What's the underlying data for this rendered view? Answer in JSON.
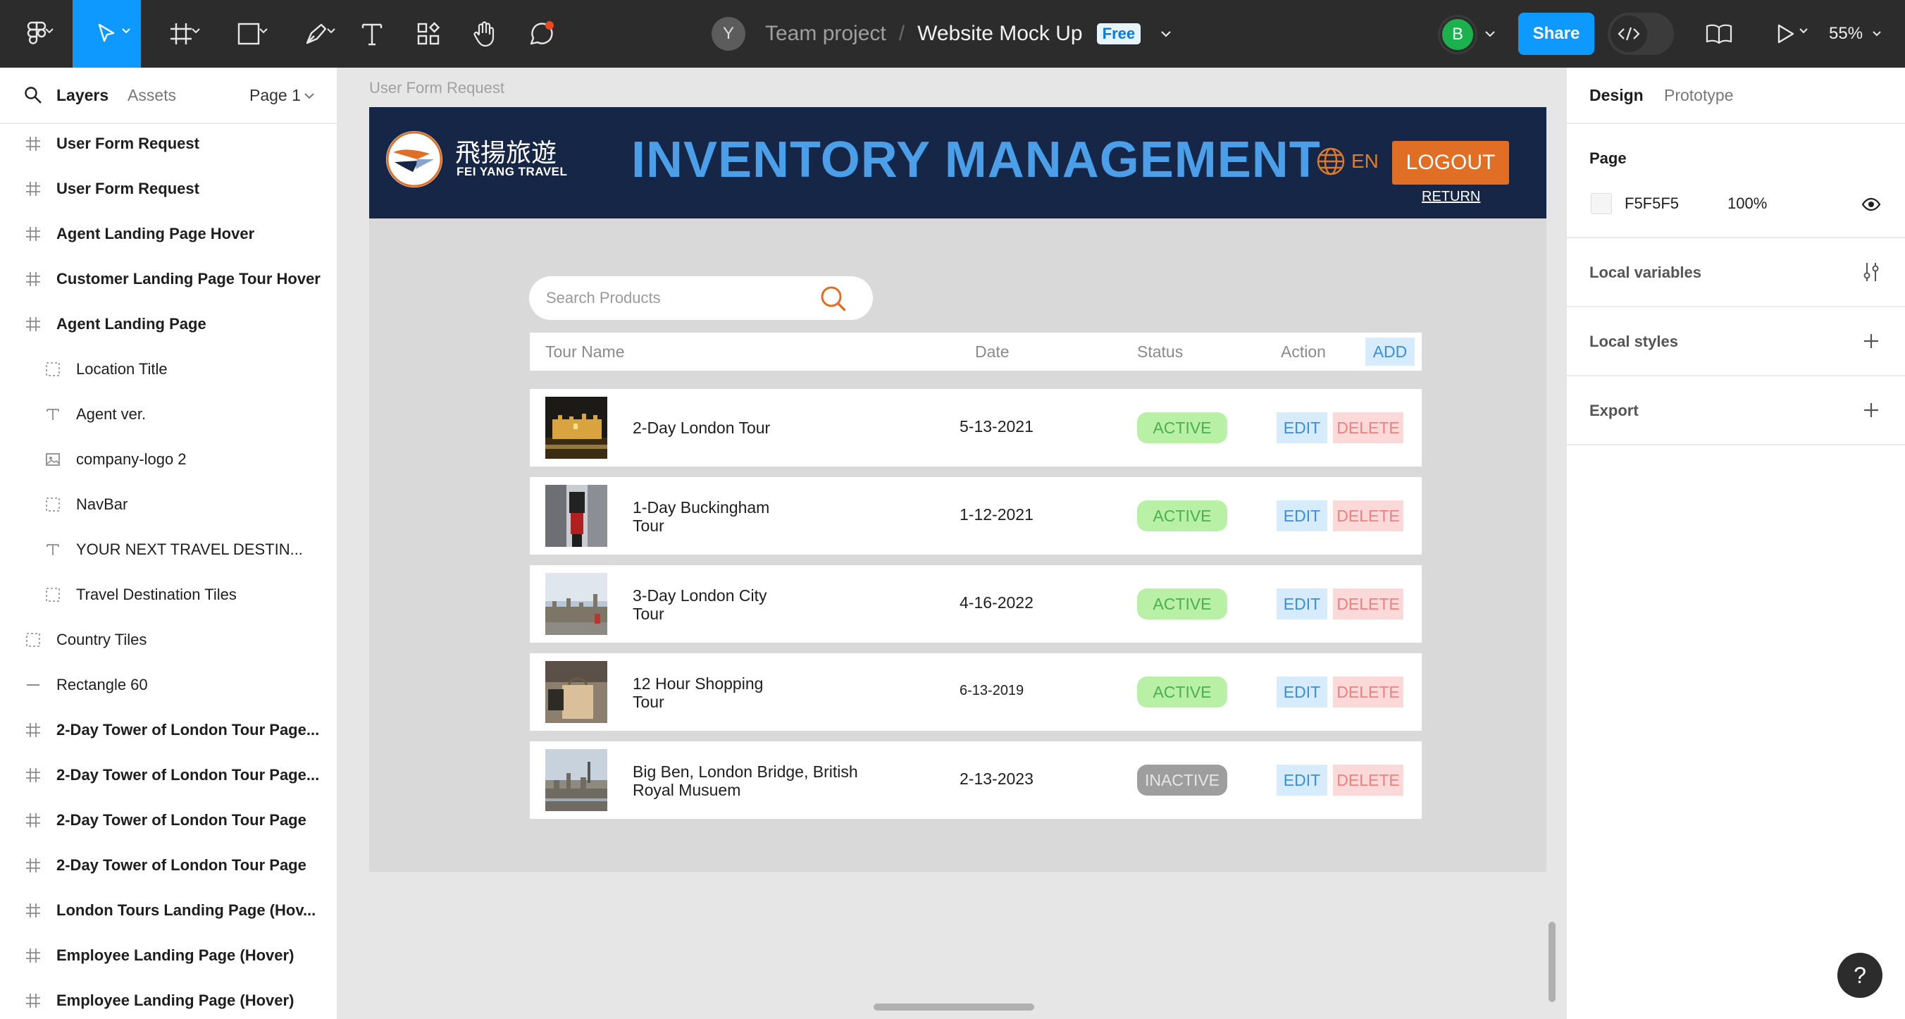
{
  "toolbar": {
    "file": {
      "team": "Team project",
      "separator": "/",
      "name": "Website Mock Up",
      "plan_badge": "Free",
      "team_avatar": "Y"
    },
    "user_avatar": "B",
    "share_label": "Share",
    "zoom": "55%",
    "icons": [
      "figma-menu-icon",
      "move-tool-icon",
      "frame-tool-icon",
      "rectangle-tool-icon",
      "pen-tool-icon",
      "text-tool-icon",
      "resources-icon",
      "hand-tool-icon",
      "comment-tool-icon",
      "dev-mode-icon",
      "library-icon",
      "present-icon"
    ],
    "accent": "#0d99ff"
  },
  "left_panel": {
    "tabs": {
      "layers": "Layers",
      "assets": "Assets"
    },
    "page_select": "Page 1",
    "layers": [
      {
        "name": "User Form Request",
        "type": "frame"
      },
      {
        "name": "User Form Request",
        "type": "frame"
      },
      {
        "name": "Agent Landing Page Hover",
        "type": "frame"
      },
      {
        "name": "Customer Landing Page Tour Hover",
        "type": "frame"
      },
      {
        "name": "Agent Landing Page",
        "type": "frame"
      },
      {
        "name": "Location Title",
        "type": "group"
      },
      {
        "name": "Agent ver.",
        "type": "text"
      },
      {
        "name": "company-logo 2",
        "type": "image"
      },
      {
        "name": "NavBar",
        "type": "group"
      },
      {
        "name": "YOUR NEXT TRAVEL DESTIN...",
        "type": "text"
      },
      {
        "name": "Travel Destination Tiles",
        "type": "group"
      },
      {
        "name": "Country Tiles",
        "type": "group"
      },
      {
        "name": "Rectangle 60",
        "type": "line"
      },
      {
        "name": "2-Day Tower of London Tour Page...",
        "type": "frame"
      },
      {
        "name": "2-Day Tower of London Tour Page...",
        "type": "frame"
      },
      {
        "name": "2-Day Tower of London Tour Page",
        "type": "frame"
      },
      {
        "name": "2-Day Tower of London Tour Page",
        "type": "frame"
      },
      {
        "name": "London Tours Landing Page (Hov...",
        "type": "frame"
      },
      {
        "name": "Employee Landing Page (Hover)",
        "type": "frame"
      },
      {
        "name": "Employee Landing Page (Hover)",
        "type": "frame"
      }
    ]
  },
  "canvas": {
    "frame_label": "User Form Request",
    "nav": {
      "logo_cn": "飛揚旅遊",
      "logo_en": "FEI YANG TRAVEL",
      "title": "INVENTORY MANAGEMENT",
      "lang": "EN",
      "logout": "LOGOUT",
      "return": "RETURN",
      "bg_color": "#152646",
      "title_color": "#4a9fe8",
      "accent_color": "#e06f25"
    },
    "search_placeholder": "Search Products",
    "table": {
      "headers": {
        "tour": "Tour Name",
        "date": "Date",
        "status": "Status",
        "action": "Action"
      },
      "add_label": "ADD",
      "edit_label": "EDIT",
      "delete_label": "DELETE",
      "rows": [
        {
          "tour": [
            "2-Day London Tour"
          ],
          "date": "5-13-2021",
          "status": "ACTIVE",
          "thumb": "tower-of-london-night"
        },
        {
          "tour": [
            "1-Day Buckingham",
            "Tour"
          ],
          "date": "1-12-2021",
          "status": "ACTIVE",
          "thumb": "buckingham-guard"
        },
        {
          "tour": [
            "3-Day London City",
            "Tour"
          ],
          "date": "4-16-2022",
          "status": "ACTIVE",
          "thumb": "parliament"
        },
        {
          "tour": [
            "12 Hour Shopping",
            "Tour"
          ],
          "date": "6-13-2019",
          "status": "ACTIVE",
          "thumb": "shopping-bag"
        },
        {
          "tour": [
            "Big Ben, London Bridge, British",
            "Royal Musuem"
          ],
          "date": "2-13-2023",
          "status": "INACTIVE",
          "thumb": "london-skyline"
        }
      ]
    }
  },
  "right_panel": {
    "tabs": {
      "design": "Design",
      "prototype": "Prototype"
    },
    "page_section": {
      "title": "Page",
      "color": "F5F5F5",
      "opacity": "100%"
    },
    "local_variables": "Local variables",
    "local_styles": "Local styles",
    "export": "Export"
  },
  "help": "?"
}
